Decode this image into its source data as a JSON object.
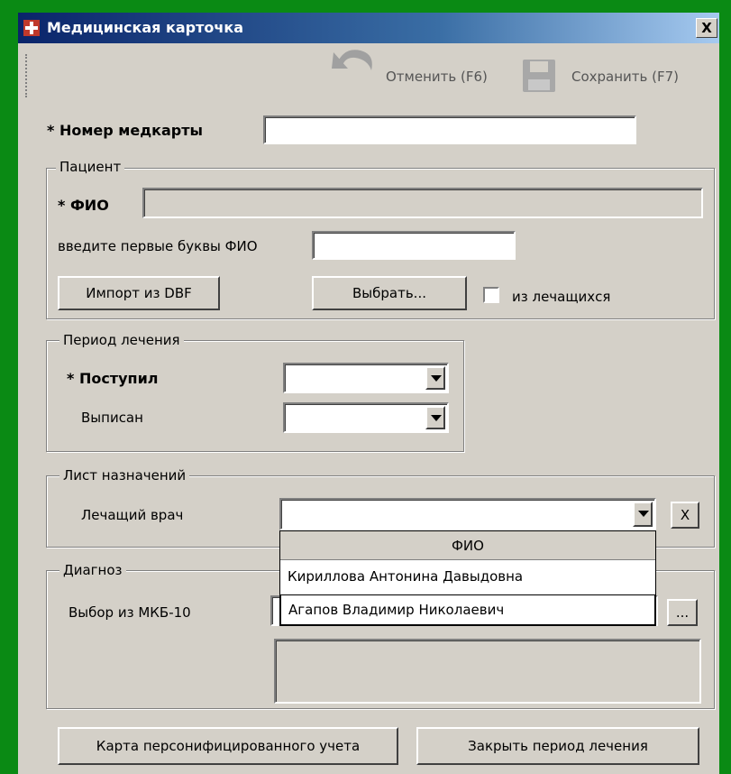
{
  "window": {
    "title": "Медицинская карточка",
    "close_glyph": "X"
  },
  "toolbar": {
    "undo_label": "Отменить (F6)",
    "save_label": "Сохранить (F7)"
  },
  "record": {
    "label": "* Номер медкарты",
    "value": ""
  },
  "patient": {
    "group_label": "Пациент",
    "fio_label": "* ФИО",
    "fio_value": "",
    "search_label": "введите первые буквы ФИО",
    "search_value": "",
    "import_button": "Импорт из DBF",
    "select_button": "Выбрать...",
    "checkbox_label": "из лечащихся",
    "checkbox_checked": false
  },
  "period": {
    "group_label": "Период лечения",
    "admitted_label": "* Поступил",
    "admitted_value": "",
    "discharged_label": "Выписан",
    "discharged_value": ""
  },
  "prescriptions": {
    "group_label": "Лист назначений",
    "doctor_label": "Лечащий врач",
    "doctor_value": "",
    "clear_button": "X",
    "dropdown": {
      "header": "ФИО",
      "items": [
        "Кириллова Антонина Давыдовна",
        "Агапов Владимир Николаевич"
      ],
      "selected_index": 1
    }
  },
  "diagnosis": {
    "group_label": "Диагноз",
    "mkb_label": "Выбор из МКБ-10",
    "mkb_value": "",
    "browse_button": "...",
    "description": ""
  },
  "footer": {
    "card_button": "Карта персонифицированного учета",
    "close_period_button": "Закрыть период лечения"
  },
  "icons": [
    "app-icon",
    "close-icon",
    "undo-icon",
    "save-icon",
    "chevron-down-icon"
  ]
}
